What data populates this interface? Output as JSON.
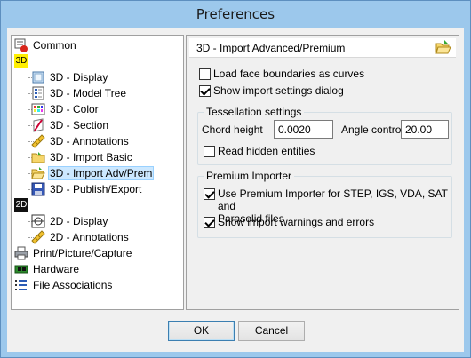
{
  "window": {
    "title": "Preferences"
  },
  "tree": {
    "items": [
      {
        "label": "Common",
        "icon": "common-settings-icon"
      },
      {
        "label": "3D",
        "icon": "3d-badge"
      },
      {
        "label": "3D - Display",
        "icon": "display-icon"
      },
      {
        "label": "3D - Model Tree",
        "icon": "model-tree-icon"
      },
      {
        "label": "3D - Color",
        "icon": "color-palette-icon"
      },
      {
        "label": "3D - Section",
        "icon": "section-icon"
      },
      {
        "label": "3D - Annotations",
        "icon": "ruler-icon"
      },
      {
        "label": "3D - Import Basic",
        "icon": "folder-icon"
      },
      {
        "label": "3D - Import Adv/Prem",
        "icon": "folder-open-icon",
        "selected": true
      },
      {
        "label": "3D - Publish/Export",
        "icon": "save-disk-icon"
      },
      {
        "label": "2D",
        "icon": "2d-badge"
      },
      {
        "label": "2D - Display",
        "icon": "display-icon"
      },
      {
        "label": "2D - Annotations",
        "icon": "ruler-icon"
      },
      {
        "label": "Print/Picture/Capture",
        "icon": "printer-icon"
      },
      {
        "label": "Hardware",
        "icon": "hardware-chip-icon"
      },
      {
        "label": "File Associations",
        "icon": "file-associations-icon"
      }
    ]
  },
  "panel": {
    "title": "3D - Import Advanced/Premium",
    "load_face_boundaries": {
      "label": "Load face boundaries as curves",
      "checked": false
    },
    "show_import_settings": {
      "label": "Show import settings dialog",
      "checked": true
    },
    "tessellation": {
      "title": "Tessellation settings",
      "chord_height_label": "Chord height",
      "chord_height_value": "0.0020",
      "angle_control_label": "Angle control",
      "angle_control_value": "20.00",
      "read_hidden": {
        "label": "Read hidden entities",
        "checked": false
      }
    },
    "premium": {
      "title": "Premium Importer",
      "use_premium": {
        "label_line1": "Use Premium Importer for STEP, IGS, VDA, SAT and",
        "label_line2": "Parasolid files",
        "checked": true
      },
      "show_warnings": {
        "label": "Show import warnings and errors",
        "checked": true
      }
    }
  },
  "buttons": {
    "ok": "OK",
    "cancel": "Cancel"
  },
  "colors": {
    "titlebar": "#9cc8ec",
    "selection": "#cce8ff"
  }
}
